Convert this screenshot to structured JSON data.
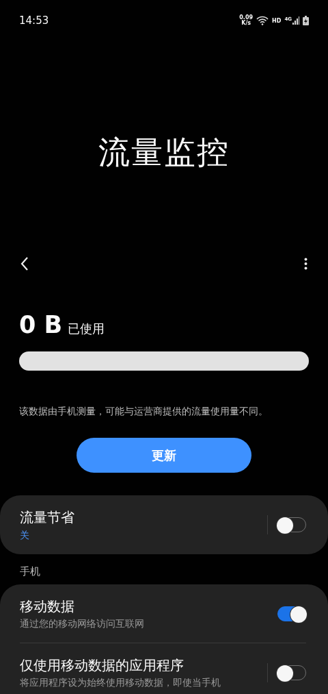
{
  "status_bar": {
    "time": "14:53",
    "speed": "0.09",
    "speed_unit": "K/s",
    "hd": "HD",
    "network": "4G"
  },
  "title": "流量监控",
  "usage": {
    "amount": "0 B",
    "label": "已使用",
    "level": 0
  },
  "note": "该数据由手机测量，可能与运营商提供的流量使用量不同。",
  "update_button": "更新",
  "data_saver": {
    "title": "流量节省",
    "status": "关",
    "on": false
  },
  "section_header": "手机",
  "mobile_rows": [
    {
      "title": "移动数据",
      "subtitle": "通过您的移动网络访问互联网",
      "on": true,
      "divider": false
    },
    {
      "title": "仅使用移动数据的应用程序",
      "subtitle": "将应用程序设为始终使用移动数据，即使当手机",
      "on": false,
      "divider": true
    }
  ]
}
